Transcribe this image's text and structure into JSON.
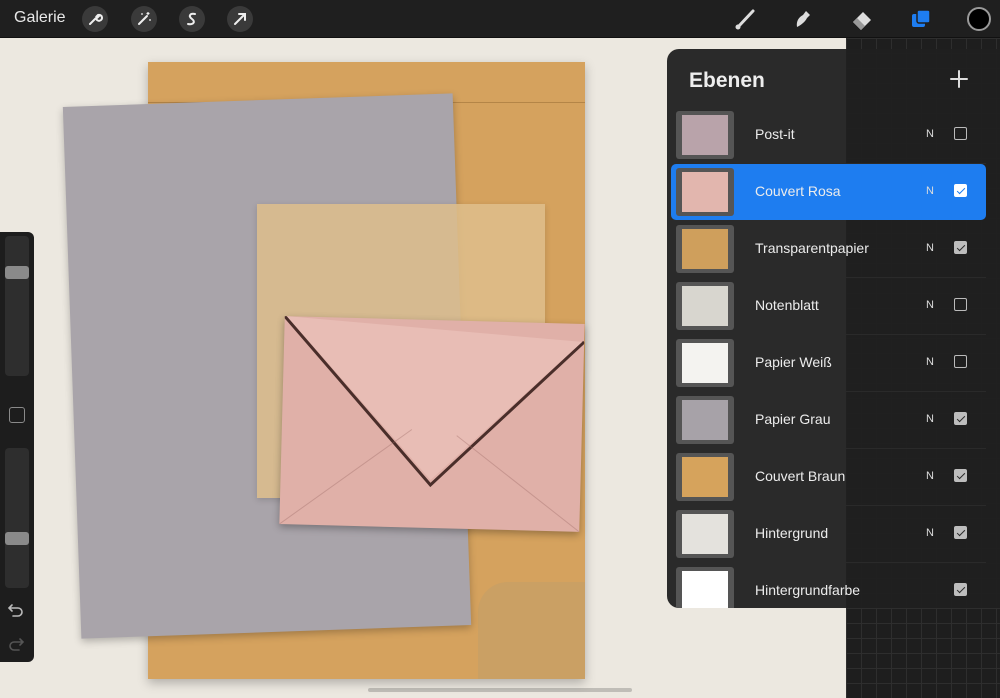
{
  "topbar": {
    "gallery_label": "Galerie",
    "left_tools": [
      "wrench-icon",
      "magic-wand-icon",
      "selection-s-icon",
      "transform-arrow-icon"
    ],
    "right_tools": [
      "brush-icon",
      "smudge-icon",
      "eraser-icon",
      "layers-icon",
      "color-swatch"
    ],
    "active_color": "#000000",
    "layers_accent": "#1e7df0"
  },
  "layers_panel": {
    "title": "Ebenen",
    "add_icon": "plus-icon",
    "layers": [
      {
        "name": "Post-it",
        "blend": "N",
        "visible": false,
        "selected": false,
        "thumb_color": "#b9a3aa"
      },
      {
        "name": "Couvert Rosa",
        "blend": "N",
        "visible": true,
        "selected": true,
        "thumb_color": "#e2b6ae"
      },
      {
        "name": "Transparentpapier",
        "blend": "N",
        "visible": true,
        "selected": false,
        "thumb_color": "#cf9f5c"
      },
      {
        "name": "Notenblatt",
        "blend": "N",
        "visible": false,
        "selected": false,
        "thumb_color": "#d8d6cf"
      },
      {
        "name": "Papier Weiß",
        "blend": "N",
        "visible": false,
        "selected": false,
        "thumb_color": "#f4f3f0"
      },
      {
        "name": "Papier Grau",
        "blend": "N",
        "visible": true,
        "selected": false,
        "thumb_color": "#a7a2a8"
      },
      {
        "name": "Couvert Braun",
        "blend": "N",
        "visible": true,
        "selected": false,
        "thumb_color": "#d6a35c"
      },
      {
        "name": "Hintergrund",
        "blend": "N",
        "visible": true,
        "selected": false,
        "thumb_color": "#e4e2dd"
      },
      {
        "name": "Hintergrundfarbe",
        "blend": "",
        "visible": true,
        "selected": false,
        "thumb_color": "#ffffff"
      }
    ]
  },
  "sidebar": {
    "brush_size_level": 0.24,
    "opacity_level": 0.66,
    "undo_icon": "undo-icon",
    "redo_icon": "redo-icon",
    "modify_button_icon": "square-icon"
  }
}
